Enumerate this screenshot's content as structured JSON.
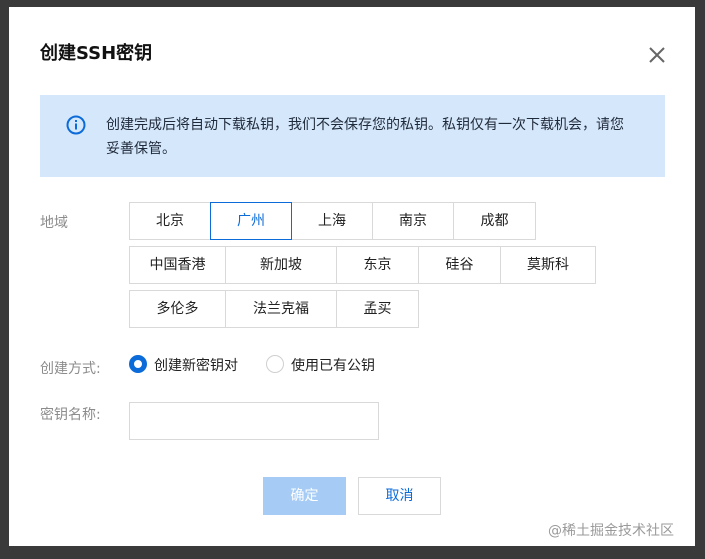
{
  "dialog": {
    "title": "创建SSH密钥",
    "notice": "创建完成后将自动下载私钥，我们不会保存您的私钥。私钥仅有一次下载机会，请您妥善保管。"
  },
  "region": {
    "label": "地域",
    "options": [
      "北京",
      "广州",
      "上海",
      "南京",
      "成都",
      "中国香港",
      "新加坡",
      "东京",
      "硅谷",
      "莫斯科",
      "多伦多",
      "法兰克福",
      "孟买"
    ],
    "selected": "广州"
  },
  "method": {
    "label": "创建方式:",
    "options": [
      "创建新密钥对",
      "使用已有公钥"
    ],
    "selected": "创建新密钥对"
  },
  "key_name": {
    "label": "密钥名称:",
    "value": ""
  },
  "buttons": {
    "confirm": "确定",
    "cancel": "取消"
  },
  "watermark": "@稀土掘金技术社区",
  "colors": {
    "accent": "#0b6bd9",
    "notice_bg": "#d5e7fb",
    "confirm_disabled": "#a6ccf5"
  }
}
